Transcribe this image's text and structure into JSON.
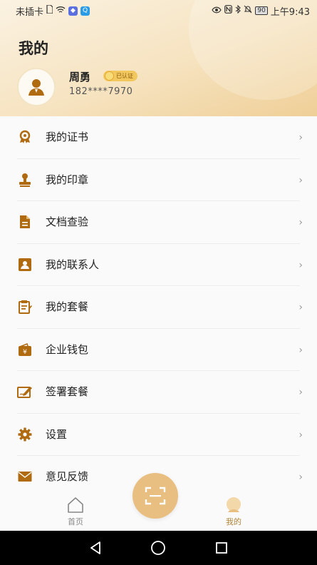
{
  "status_bar": {
    "carrier": "未插卡",
    "time": "上午9:43",
    "battery": "90"
  },
  "header": {
    "title": "我的"
  },
  "profile": {
    "name": "周勇",
    "badge": "已认证",
    "phone": "182****7970"
  },
  "menu": [
    {
      "label": "我的证书",
      "icon": "certificate-icon"
    },
    {
      "label": "我的印章",
      "icon": "stamp-icon"
    },
    {
      "label": "文档查验",
      "icon": "document-icon"
    },
    {
      "label": "我的联系人",
      "icon": "contacts-icon"
    },
    {
      "label": "我的套餐",
      "icon": "package-icon"
    },
    {
      "label": "企业钱包",
      "icon": "wallet-icon"
    },
    {
      "label": "签署套餐",
      "icon": "sign-package-icon"
    },
    {
      "label": "设置",
      "icon": "gear-icon"
    },
    {
      "label": "意见反馈",
      "icon": "mail-icon"
    }
  ],
  "tabbar": {
    "home": "首页",
    "mine": "我的"
  },
  "colors": {
    "accent": "#b06b11",
    "header_gradient_end": "#efcf97",
    "scan_button": "#e8bf80"
  }
}
